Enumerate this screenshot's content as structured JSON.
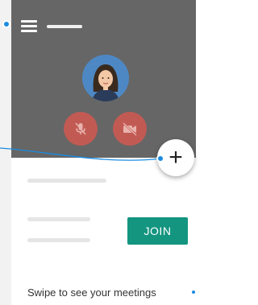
{
  "menu": {
    "icon": "hamburger-menu-icon"
  },
  "call": {
    "avatar": "user-avatar",
    "mic_icon": "mic-off-icon",
    "camera_icon": "camera-off-icon"
  },
  "fab": {
    "label": "+"
  },
  "meeting": {
    "join_label": "JOIN"
  },
  "footer": {
    "hint": "Swipe to see your meetings"
  },
  "colors": {
    "hero_bg": "#666666",
    "control_red": "#c25a54",
    "join_green": "#149580",
    "guide_blue": "#1a8be0"
  }
}
